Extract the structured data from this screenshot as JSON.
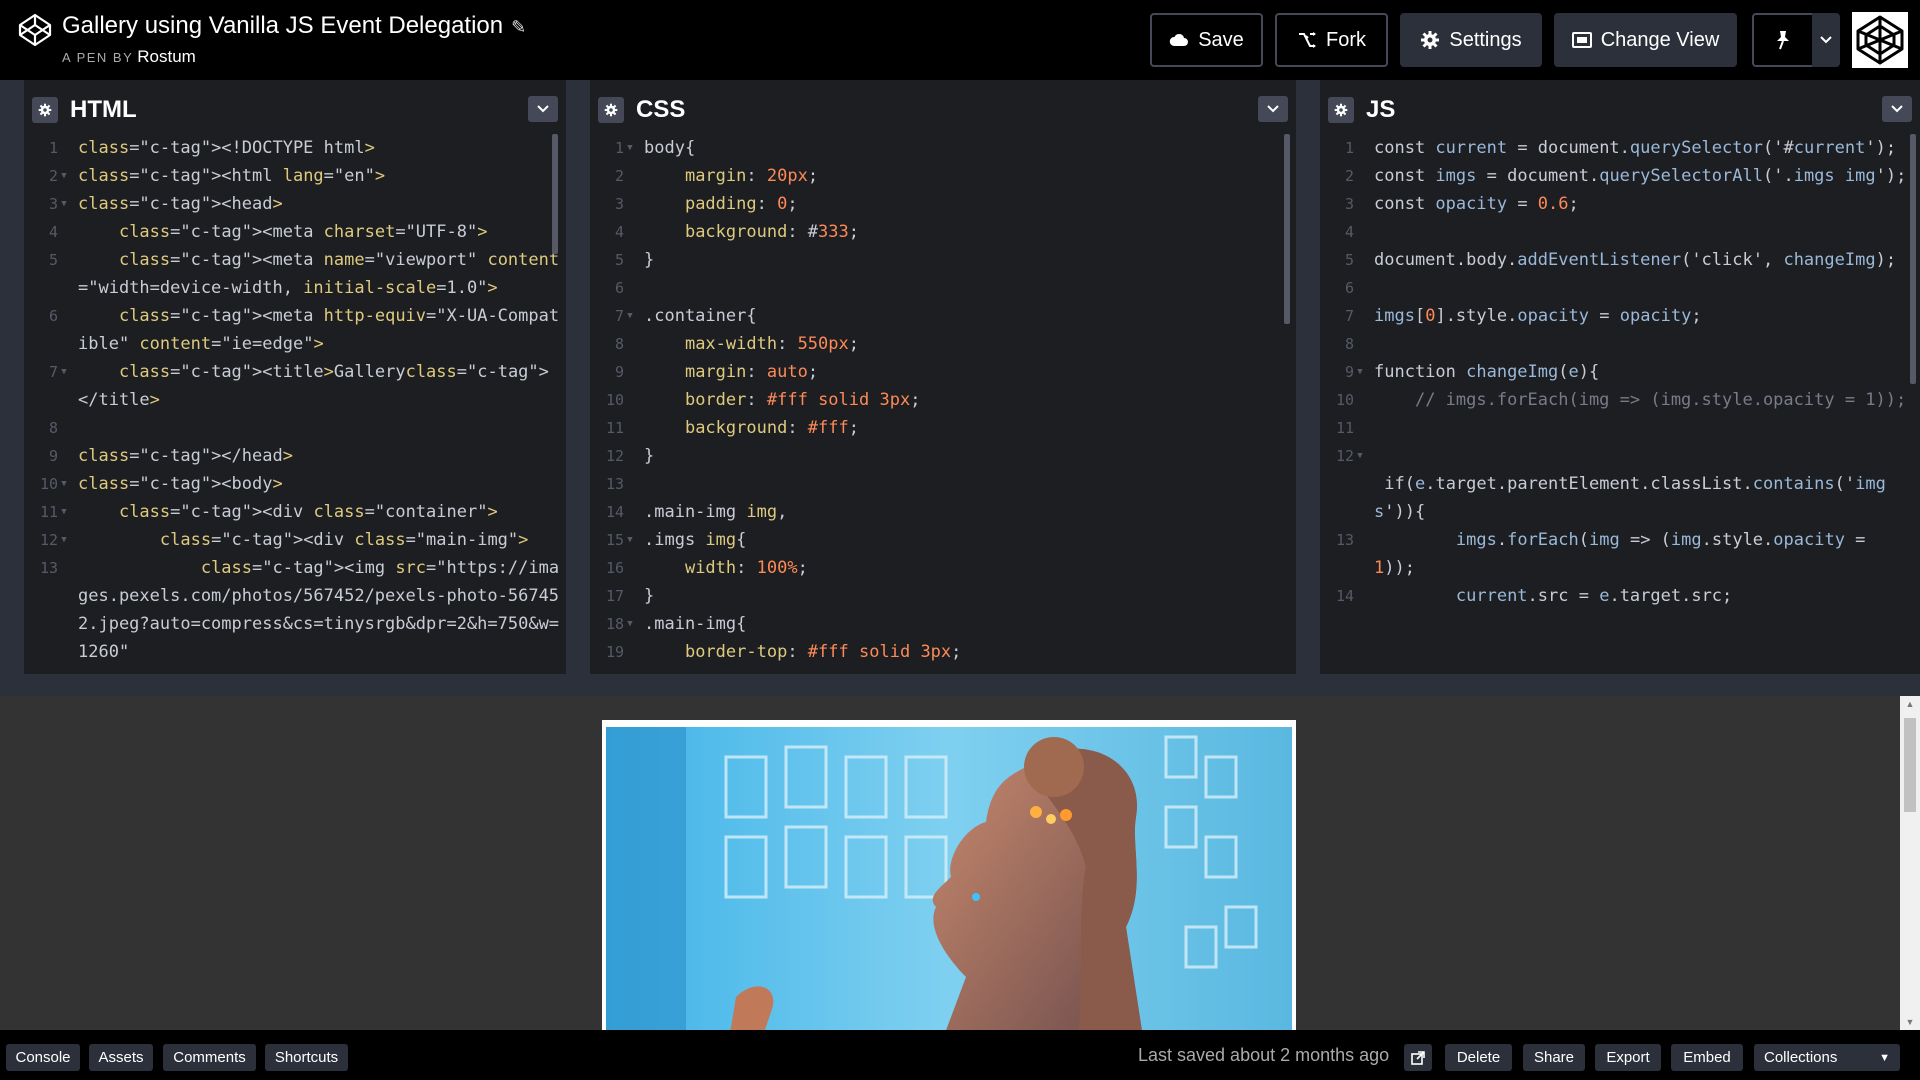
{
  "header": {
    "title": "Gallery using Vanilla JS Event Delegation",
    "pen_by": "A PEN BY",
    "author": "Rostum",
    "buttons": {
      "save": "Save",
      "fork": "Fork",
      "settings": "Settings",
      "change_view": "Change View"
    }
  },
  "editors": {
    "html": {
      "title": "HTML",
      "lines": [
        {
          "n": "1",
          "fold": false,
          "text": "<!DOCTYPE html>"
        },
        {
          "n": "2",
          "fold": true,
          "text": "<html lang=\"en\">"
        },
        {
          "n": "3",
          "fold": true,
          "text": "<head>"
        },
        {
          "n": "4",
          "fold": false,
          "text": "    <meta charset=\"UTF-8\">"
        },
        {
          "n": "5",
          "fold": false,
          "text": "    <meta name=\"viewport\" content=\"width=device-width, initial-scale=1.0\">"
        },
        {
          "n": "6",
          "fold": false,
          "text": "    <meta http-equiv=\"X-UA-Compatible\" content=\"ie=edge\">"
        },
        {
          "n": "7",
          "fold": true,
          "text": "    <title>Gallery</title>"
        },
        {
          "n": "8",
          "fold": false,
          "text": ""
        },
        {
          "n": "9",
          "fold": false,
          "text": "</head>"
        },
        {
          "n": "10",
          "fold": true,
          "text": "<body>"
        },
        {
          "n": "11",
          "fold": true,
          "text": "    <div class=\"container\">"
        },
        {
          "n": "12",
          "fold": true,
          "text": "        <div class=\"main-img\">"
        },
        {
          "n": "13",
          "fold": false,
          "text": "            <img src=\"https://images.pexels.com/photos/567452/pexels-photo-567452.jpeg?auto=compress&cs=tinysrgb&dpr=2&h=750&w=1260\""
        }
      ]
    },
    "css": {
      "title": "CSS",
      "lines": [
        {
          "n": "1",
          "fold": true,
          "text": "body{"
        },
        {
          "n": "2",
          "fold": false,
          "text": "    margin: 20px;"
        },
        {
          "n": "3",
          "fold": false,
          "text": "    padding: 0;"
        },
        {
          "n": "4",
          "fold": false,
          "text": "    background: #333;"
        },
        {
          "n": "5",
          "fold": false,
          "text": "}"
        },
        {
          "n": "6",
          "fold": false,
          "text": ""
        },
        {
          "n": "7",
          "fold": true,
          "text": ".container{"
        },
        {
          "n": "8",
          "fold": false,
          "text": "    max-width: 550px;"
        },
        {
          "n": "9",
          "fold": false,
          "text": "    margin: auto;"
        },
        {
          "n": "10",
          "fold": false,
          "text": "    border: #fff solid 3px;"
        },
        {
          "n": "11",
          "fold": false,
          "text": "    background: #fff;"
        },
        {
          "n": "12",
          "fold": false,
          "text": "}"
        },
        {
          "n": "13",
          "fold": false,
          "text": ""
        },
        {
          "n": "14",
          "fold": false,
          "text": ".main-img img,"
        },
        {
          "n": "15",
          "fold": true,
          "text": ".imgs img{"
        },
        {
          "n": "16",
          "fold": false,
          "text": "    width: 100%;"
        },
        {
          "n": "17",
          "fold": false,
          "text": "}"
        },
        {
          "n": "18",
          "fold": true,
          "text": ".main-img{"
        },
        {
          "n": "19",
          "fold": false,
          "text": "    border-top: #fff solid 3px;"
        }
      ]
    },
    "js": {
      "title": "JS",
      "lines": [
        {
          "n": "1",
          "fold": false,
          "text": "const current = document.querySelector('#current');"
        },
        {
          "n": "2",
          "fold": false,
          "text": "const imgs = document.querySelectorAll('.imgs img');"
        },
        {
          "n": "3",
          "fold": false,
          "text": "const opacity = 0.6;"
        },
        {
          "n": "4",
          "fold": false,
          "text": ""
        },
        {
          "n": "5",
          "fold": false,
          "text": "document.body.addEventListener('click', changeImg);"
        },
        {
          "n": "6",
          "fold": false,
          "text": ""
        },
        {
          "n": "7",
          "fold": false,
          "text": "imgs[0].style.opacity = opacity;"
        },
        {
          "n": "8",
          "fold": false,
          "text": ""
        },
        {
          "n": "9",
          "fold": true,
          "text": "function changeImg(e){"
        },
        {
          "n": "10",
          "fold": false,
          "text": "    // imgs.forEach(img => (img.style.opacity = 1));"
        },
        {
          "n": "11",
          "fold": false,
          "text": ""
        },
        {
          "n": "12",
          "fold": true,
          "text": ""
        },
        {
          "n": "",
          "fold": false,
          "text": " if(e.target.parentElement.classList.contains('imgs')){"
        },
        {
          "n": "13",
          "fold": false,
          "text": "        imgs.forEach(img => (img.style.opacity = 1));"
        },
        {
          "n": "14",
          "fold": false,
          "text": "        current.src = e.target.src;"
        }
      ]
    }
  },
  "footer": {
    "console": "Console",
    "assets": "Assets",
    "comments": "Comments",
    "shortcuts": "Shortcuts",
    "last_saved": "Last saved about 2 months ago",
    "delete": "Delete",
    "share": "Share",
    "export": "Export",
    "embed": "Embed",
    "collections": "Collections"
  },
  "icons": {
    "logo": "codepen-logo-icon",
    "pencil": "pencil-icon",
    "save": "cloud-icon",
    "fork": "fork-icon",
    "settings": "gear-icon",
    "change_view": "layout-icon",
    "pin": "pin-icon",
    "dropdown": "chevron-down-icon",
    "external": "external-link-icon"
  },
  "colors": {
    "header_bg": "#000000",
    "editor_bg": "#1d1e22",
    "panel_bar": "#2c303a",
    "preview_bg": "#333333",
    "accent_tag": "#ddca7e",
    "accent_num": "#fd8a56",
    "accent_var": "#9ab8d8"
  }
}
